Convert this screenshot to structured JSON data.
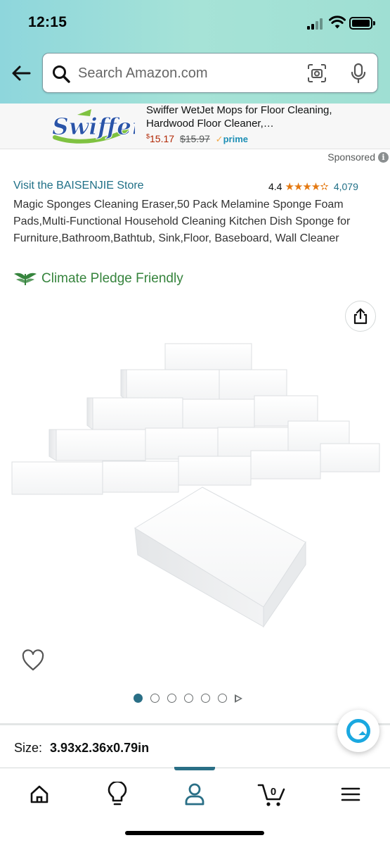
{
  "status_bar": {
    "time": "12:15"
  },
  "search": {
    "placeholder": "Search Amazon.com"
  },
  "ad": {
    "brand": "Swiffer",
    "title": "Swiffer WetJet Mops for Floor Cleaning, Hardwood Floor Cleaner,…",
    "price_symbol": "$",
    "price": "15.17",
    "old_price": "$15.97",
    "prime_check": "✓",
    "prime_label": "prime"
  },
  "sponsored_label": "Sponsored",
  "product": {
    "store_link": "Visit the BAISENJIE Store",
    "rating": "4.4",
    "stars": "★★★★✫",
    "rating_count": "4,079",
    "title": "Magic Sponges Cleaning Eraser,50 Pack Melamine Sponge Foam Pads,Multi-Functional Household Cleaning Kitchen Dish Sponge for Furniture,Bathroom,Bathtub, Sink,Floor, Baseboard, Wall Cleaner",
    "climate_label": "Climate Pledge Friendly",
    "image_count": 6,
    "active_image_index": 0,
    "has_video": true
  },
  "size": {
    "label": "Size:",
    "value": "3.93x2.36x0.79in"
  },
  "bottom_nav": {
    "active_item": "account",
    "cart_count": "0",
    "items": [
      "home",
      "inspire",
      "account",
      "cart",
      "menu"
    ]
  },
  "colors": {
    "header_gradient": "#a6e3d7",
    "link": "#1f6f86",
    "price": "#b12704",
    "climate_green": "#36843d",
    "star_orange": "#e47911",
    "active_teal": "#2a6f86"
  }
}
